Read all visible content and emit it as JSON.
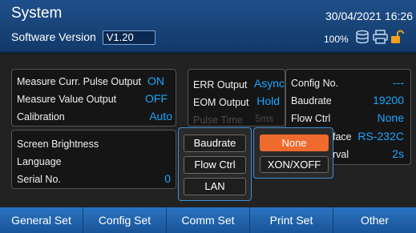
{
  "header": {
    "title": "System",
    "software_version_label": "Software Version",
    "software_version": "V1.20",
    "datetime": "30/04/2021 16:26",
    "storage_percent": "100%",
    "icons": [
      "database-icon",
      "printer-icon",
      "unlock-icon"
    ]
  },
  "left_panel": {
    "rows": [
      {
        "label": "Measure Curr. Pulse Output",
        "value": "ON"
      },
      {
        "label": "Measure Value Output",
        "value": "OFF"
      },
      {
        "label": "Calibration",
        "value": "Auto"
      }
    ]
  },
  "middle_panel": {
    "rows": [
      {
        "label": "ERR Output",
        "value": "Async"
      },
      {
        "label": "EOM Output",
        "value": "Hold"
      },
      {
        "label": "Pulse Time",
        "value": "5ms"
      }
    ]
  },
  "right_panel": {
    "rows": [
      {
        "label": "Config No.",
        "value": "---"
      },
      {
        "label": "Baudrate",
        "value": "19200"
      },
      {
        "label": "Flow Ctrl",
        "value": "None"
      },
      {
        "label": "face",
        "value": "RS-232C"
      },
      {
        "label": "rval",
        "value": "2s"
      }
    ]
  },
  "lower_left_panel": {
    "rows": [
      {
        "label": "Screen Brightness",
        "value": ""
      },
      {
        "label": "Language",
        "value": ""
      },
      {
        "label": "Serial No.",
        "value": "0"
      }
    ]
  },
  "popup_menu": {
    "items": [
      "Baudrate",
      "Flow Ctrl",
      "LAN"
    ]
  },
  "popup_options": {
    "items": [
      "None",
      "XON/XOFF"
    ],
    "selected": "None"
  },
  "tabs": [
    "General Set",
    "Config Set",
    "Comm Set",
    "Print Set",
    "Other"
  ],
  "colors": {
    "header": "#1f4f8a",
    "value": "#1aa5ff",
    "selected": "#ee6a2d",
    "tab": "#2a73c2"
  }
}
